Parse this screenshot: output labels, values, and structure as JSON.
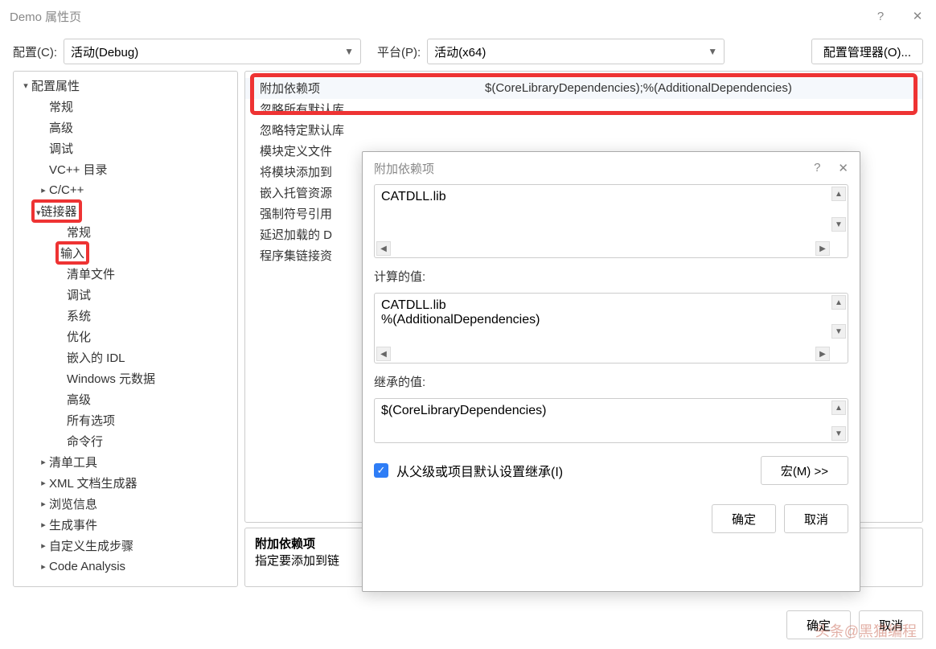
{
  "window": {
    "title": "Demo 属性页",
    "help": "?",
    "close": "✕"
  },
  "toolbar": {
    "config_label": "配置(C):",
    "config_value": "活动(Debug)",
    "platform_label": "平台(P):",
    "platform_value": "活动(x64)",
    "config_manager": "配置管理器(O)..."
  },
  "tree": [
    {
      "label": "配置属性",
      "depth": 0,
      "expanded": true
    },
    {
      "label": "常规",
      "depth": 1,
      "leaf": true
    },
    {
      "label": "高级",
      "depth": 1,
      "leaf": true
    },
    {
      "label": "调试",
      "depth": 1,
      "leaf": true
    },
    {
      "label": "VC++ 目录",
      "depth": 1,
      "leaf": true
    },
    {
      "label": "C/C++",
      "depth": 1,
      "expanded": false
    },
    {
      "label": "链接器",
      "depth": 1,
      "expanded": true,
      "highlight": true
    },
    {
      "label": "常规",
      "depth": 2,
      "leaf": true
    },
    {
      "label": "输入",
      "depth": 2,
      "leaf": true,
      "highlight": true
    },
    {
      "label": "清单文件",
      "depth": 2,
      "leaf": true
    },
    {
      "label": "调试",
      "depth": 2,
      "leaf": true
    },
    {
      "label": "系统",
      "depth": 2,
      "leaf": true
    },
    {
      "label": "优化",
      "depth": 2,
      "leaf": true
    },
    {
      "label": "嵌入的 IDL",
      "depth": 2,
      "leaf": true
    },
    {
      "label": "Windows 元数据",
      "depth": 2,
      "leaf": true
    },
    {
      "label": "高级",
      "depth": 2,
      "leaf": true
    },
    {
      "label": "所有选项",
      "depth": 2,
      "leaf": true
    },
    {
      "label": "命令行",
      "depth": 2,
      "leaf": true
    },
    {
      "label": "清单工具",
      "depth": 1,
      "expanded": false
    },
    {
      "label": "XML 文档生成器",
      "depth": 1,
      "expanded": false
    },
    {
      "label": "浏览信息",
      "depth": 1,
      "expanded": false
    },
    {
      "label": "生成事件",
      "depth": 1,
      "expanded": false
    },
    {
      "label": "自定义生成步骤",
      "depth": 1,
      "expanded": false
    },
    {
      "label": "Code Analysis",
      "depth": 1,
      "expanded": false
    }
  ],
  "grid": [
    {
      "label": "附加依赖项",
      "value": "$(CoreLibraryDependencies);%(AdditionalDependencies)",
      "selected": true
    },
    {
      "label": "忽略所有默认库",
      "value": ""
    },
    {
      "label": "忽略特定默认库",
      "value": ""
    },
    {
      "label": "模块定义文件",
      "value": ""
    },
    {
      "label": "将模块添加到",
      "value": ""
    },
    {
      "label": "嵌入托管资源",
      "value": ""
    },
    {
      "label": "强制符号引用",
      "value": ""
    },
    {
      "label": "延迟加载的 D",
      "value": ""
    },
    {
      "label": "程序集链接资",
      "value": ""
    }
  ],
  "desc": {
    "title": "附加依赖项",
    "text": "指定要添加到链"
  },
  "popup": {
    "title": "附加依赖项",
    "help": "?",
    "close": "✕",
    "input_value": "CATDLL.lib",
    "computed_label": "计算的值:",
    "computed_line1": "CATDLL.lib",
    "computed_line2": "%(AdditionalDependencies)",
    "inherited_label": "继承的值:",
    "inherited_value": "$(CoreLibraryDependencies)",
    "inherit_checkbox": "从父级或项目默认设置继承(I)",
    "macro_btn": "宏(M) >>",
    "ok": "确定",
    "cancel": "取消"
  },
  "footer": {
    "ok": "确定",
    "cancel": "取消"
  },
  "watermark": "头条@黑猫编程"
}
